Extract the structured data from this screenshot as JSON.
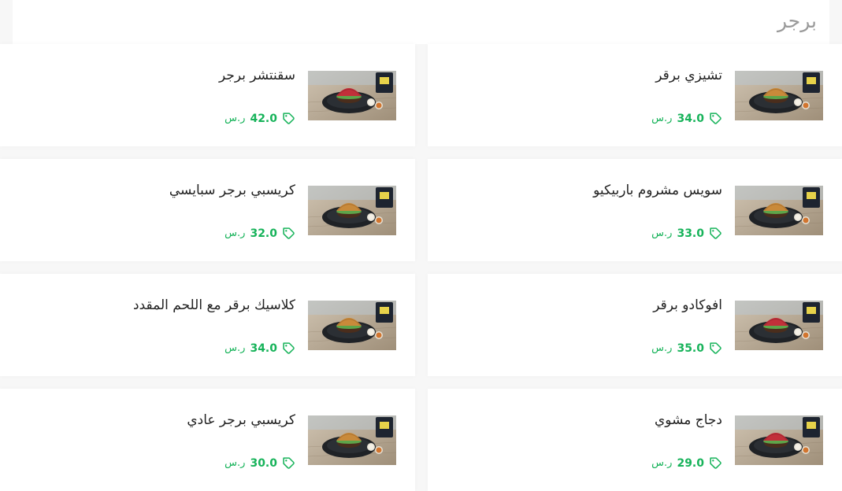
{
  "section": {
    "title": "برجر"
  },
  "items": [
    {
      "name": "سقنتشر برجر",
      "price": "42.0",
      "currency": "ر.س",
      "bun": "red"
    },
    {
      "name": "تشيزي برقر",
      "price": "34.0",
      "currency": "ر.س",
      "bun": "golden"
    },
    {
      "name": "كريسبي برجر سبايسي",
      "price": "32.0",
      "currency": "ر.س",
      "bun": "golden"
    },
    {
      "name": "سويس مشروم باربيكيو",
      "price": "33.0",
      "currency": "ر.س",
      "bun": "golden"
    },
    {
      "name": "كلاسيك برقر مع اللحم المقدد",
      "price": "34.0",
      "currency": "ر.س",
      "bun": "golden"
    },
    {
      "name": "افوكادو برقر",
      "price": "35.0",
      "currency": "ر.س",
      "bun": "red"
    },
    {
      "name": "كريسبي برجر عادي",
      "price": "30.0",
      "currency": "ر.س",
      "bun": "golden"
    },
    {
      "name": "دجاج مشوي",
      "price": "29.0",
      "currency": "ر.س",
      "bun": "red"
    }
  ],
  "colors": {
    "accent": "#17b35a",
    "title": "#9a9a9a",
    "text": "#222222"
  },
  "icons": {
    "price": "price-tag-icon"
  }
}
